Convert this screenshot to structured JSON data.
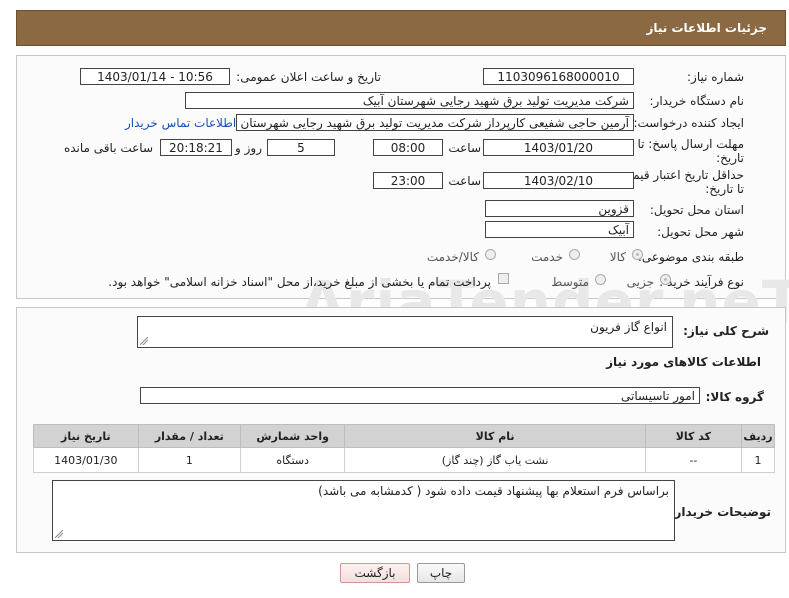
{
  "header": {
    "title": "جزئیات اطلاعات نیاز"
  },
  "form": {
    "need_number_label": "شماره نیاز:",
    "need_number": "1103096168000010",
    "announce_label": "تاریخ و ساعت اعلان عمومی:",
    "announce_value": "1403/01/14 - 10:56",
    "buyer_org_label": "نام دستگاه خریدار:",
    "buyer_org": "شرکت مدیریت تولید برق شهید رجایی شهرستان آبیک",
    "creator_label": "ایجاد کننده درخواست:",
    "creator": "آرمین حاجی شفیعی کارپرداز شرکت مدیریت تولید برق شهید رجایی شهرستان",
    "contact_link": "اطلاعات تماس خریدار",
    "reply_deadline_label": "مهلت ارسال پاسخ: تا تاریخ:",
    "reply_date": "1403/01/20",
    "time_label": "ساعت",
    "reply_time": "08:00",
    "days_value": "5",
    "days_label": "روز و",
    "remaining_time": "20:18:21",
    "remaining_label": "ساعت باقی مانده",
    "price_deadline_label": "حداقل تاریخ اعتبار قیمت: تا تاریخ:",
    "price_date": "1403/02/10",
    "price_time": "23:00",
    "province_label": "استان محل تحویل:",
    "province": "قزوین",
    "city_label": "شهر محل تحویل:",
    "city": "آبیک",
    "category_label": "طبقه بندی موضوعی:",
    "category_options": [
      "کالا",
      "خدمت",
      "کالا/خدمت"
    ],
    "process_label": "نوع فرآیند خرید :",
    "process_options": [
      "جزیی",
      "متوسط"
    ],
    "payment_note": "پرداخت تمام یا بخشی از مبلغ خرید،از محل \"اسناد خزانه اسلامی\" خواهد بود."
  },
  "details": {
    "description_label": "شرح کلی نیاز:",
    "description": "انواع گاز فریون",
    "goods_info_title": "اطلاعات کالاهای مورد نیاز",
    "goods_group_label": "گروه کالا:",
    "goods_group": "امور تاسیساتی",
    "table": {
      "headers": [
        "ردیف",
        "کد کالا",
        "نام کالا",
        "واحد شمارش",
        "تعداد / مقدار",
        "تاریخ نیاز"
      ],
      "rows": [
        [
          "1",
          "--",
          "نشت یاب گاز (چند گاز)",
          "دستگاه",
          "1",
          "1403/01/30"
        ]
      ]
    },
    "buyer_notes_label": "توضیحات خریدار:",
    "buyer_notes": "براساس فرم استعلام بها پیشنهاد قیمت داده شود ( کدمشابه می باشد)"
  },
  "buttons": {
    "print": "چاپ",
    "back": "بازگشت"
  },
  "watermark": "AriaTender.neT"
}
